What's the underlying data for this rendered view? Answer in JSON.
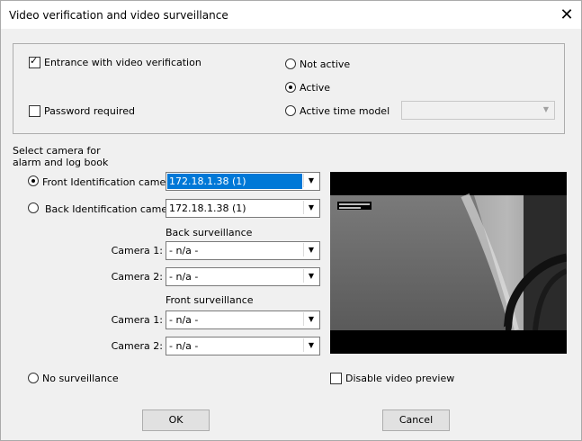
{
  "window": {
    "title": "Video verification and video surveillance"
  },
  "verification": {
    "entrance_label": "Entrance with video verification",
    "password_label": "Password required",
    "not_active_label": "Not active",
    "active_label": "Active",
    "active_time_model_label": "Active time model",
    "time_model_value": ""
  },
  "camera_select": {
    "heading_line1": "Select camera for",
    "heading_line2": "alarm and log book",
    "front_id_label": "Front Identification camera:",
    "front_id_value": "172.18.1.38 (1)",
    "back_id_label": "Back Identification camera:",
    "back_id_value": "172.18.1.38 (1)",
    "back_surveillance_heading": "Back surveillance",
    "back_camera1_label": "Camera 1:",
    "back_camera1_value": "- n/a -",
    "back_camera2_label": "Camera 2:",
    "back_camera2_value": "- n/a -",
    "front_surveillance_heading": "Front surveillance",
    "front_camera1_label": "Camera 1:",
    "front_camera1_value": "- n/a -",
    "front_camera2_label": "Camera 2:",
    "front_camera2_value": "- n/a -",
    "no_surveillance_label": "No surveillance"
  },
  "preview": {
    "disable_label": "Disable video preview"
  },
  "buttons": {
    "ok": "OK",
    "cancel": "Cancel"
  },
  "icons": {
    "close": "close-icon",
    "dropdown": "chevron-down-icon"
  },
  "colors": {
    "selection": "#0078d7",
    "background": "#f0f0f0"
  }
}
